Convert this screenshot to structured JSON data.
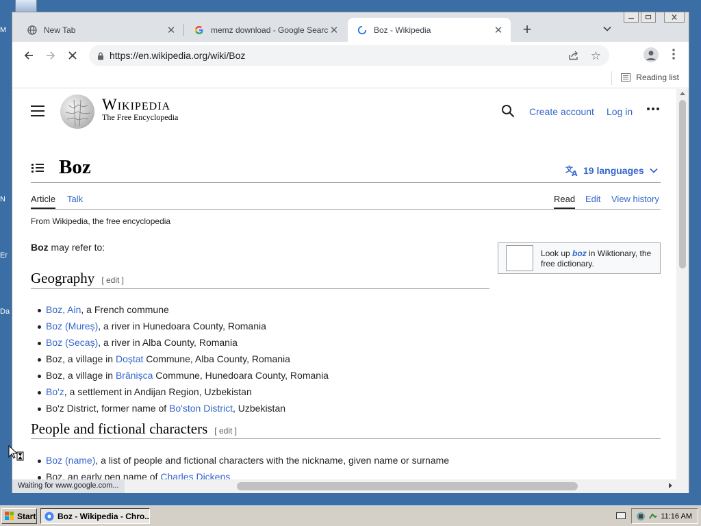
{
  "desktop": {
    "labels": [
      "M",
      "N",
      "Er",
      "Da"
    ]
  },
  "tabs": [
    {
      "title": "New Tab",
      "icon": "globe-icon"
    },
    {
      "title": "memz download - Google Search",
      "icon": "google-icon"
    },
    {
      "title": "Boz - Wikipedia",
      "icon": "loading-icon"
    }
  ],
  "toolbar": {
    "url": "https://en.wikipedia.org/wiki/Boz"
  },
  "bookmarks": {
    "reading_list": "Reading list"
  },
  "wiki": {
    "wordmark": "Wikipedia",
    "tagline": "The Free Encyclopedia",
    "create_account": "Create account",
    "log_in": "Log in",
    "title": "Boz",
    "languages": "19 languages",
    "tabs_left": [
      "Article",
      "Talk"
    ],
    "tabs_right": [
      "Read",
      "Edit",
      "View history"
    ],
    "from": "From Wikipedia, the free encyclopedia",
    "refer_bold": "Boz",
    "refer_rest": " may refer to:",
    "wiktionary": {
      "pre": "Look up ",
      "term": "boz",
      "post": " in Wiktionary, the free dictionary."
    },
    "section1": {
      "heading": "Geography",
      "edit": "[ edit ]",
      "items": [
        [
          {
            "t": "Boz, Ain",
            "link": true
          },
          {
            "t": ", a French commune"
          }
        ],
        [
          {
            "t": "Boz (Mureș)",
            "link": true
          },
          {
            "t": ", a river in Hunedoara County, Romania"
          }
        ],
        [
          {
            "t": "Boz (Secaș)",
            "link": true
          },
          {
            "t": ", a river in Alba County, Romania"
          }
        ],
        [
          {
            "t": "Boz, a village in "
          },
          {
            "t": "Doștat",
            "link": true
          },
          {
            "t": " Commune, Alba County, Romania"
          }
        ],
        [
          {
            "t": "Boz, a village in "
          },
          {
            "t": "Brănișca",
            "link": true
          },
          {
            "t": " Commune, Hunedoara County, Romania"
          }
        ],
        [
          {
            "t": "Bo'z",
            "link": true
          },
          {
            "t": ", a settlement in Andijan Region, Uzbekistan"
          }
        ],
        [
          {
            "t": "Bo'z District, former name of "
          },
          {
            "t": "Bo'ston District",
            "link": true
          },
          {
            "t": ", Uzbekistan"
          }
        ]
      ]
    },
    "section2": {
      "heading": "People and fictional characters",
      "edit": "[ edit ]",
      "items": [
        [
          {
            "t": "Boz (name)",
            "link": true
          },
          {
            "t": ", a list of people and fictional characters with the nickname, given name or surname"
          }
        ],
        [
          {
            "t": "Boz, an early pen name of "
          },
          {
            "t": "Charles Dickens",
            "link": true
          }
        ]
      ]
    }
  },
  "status": {
    "text": "Waiting for www.google.com..."
  },
  "taskbar": {
    "start": "Start",
    "window": "Boz - Wikipedia - Chro...",
    "clock": "11:16 AM"
  },
  "colors": {
    "link": "#3366cc",
    "desktop": "#3a6ea5",
    "taskbar": "#d4d0c8"
  }
}
